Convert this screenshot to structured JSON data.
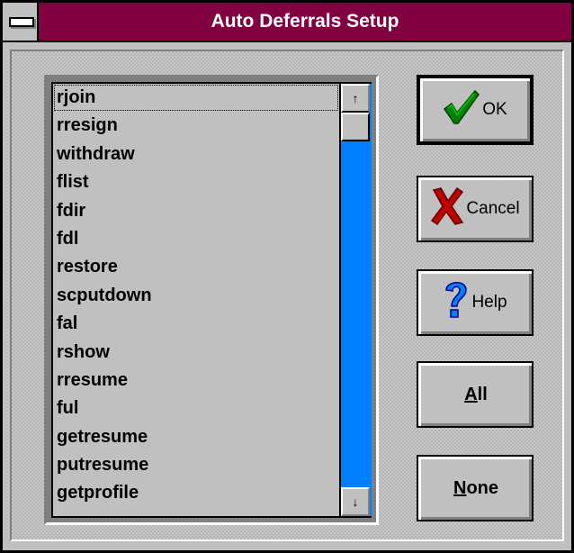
{
  "window": {
    "title": "Auto Deferrals Setup"
  },
  "list": {
    "items": [
      "rjoin",
      "rresign",
      "withdraw",
      "flist",
      "fdir",
      "fdl",
      "restore",
      "scputdown",
      "fal",
      "rshow",
      "rresume",
      "ful",
      "getresume",
      "putresume",
      "getprofile"
    ]
  },
  "buttons": {
    "ok": "OK",
    "cancel": "Cancel",
    "help": "Help",
    "all": {
      "mnemonic": "A",
      "rest": "ll"
    },
    "none": {
      "mnemonic": "N",
      "rest": "one"
    }
  },
  "scrollbar": {
    "up_glyph": "↑",
    "down_glyph": "↓",
    "thumb_position": 0.0
  },
  "icons": {
    "ok": "checkmark-icon",
    "cancel": "x-mark-icon",
    "help": "question-mark-icon"
  },
  "colors": {
    "titlebar": "#800040",
    "scrollbar_track": "#0080ff",
    "face": "#c0c0c0"
  }
}
